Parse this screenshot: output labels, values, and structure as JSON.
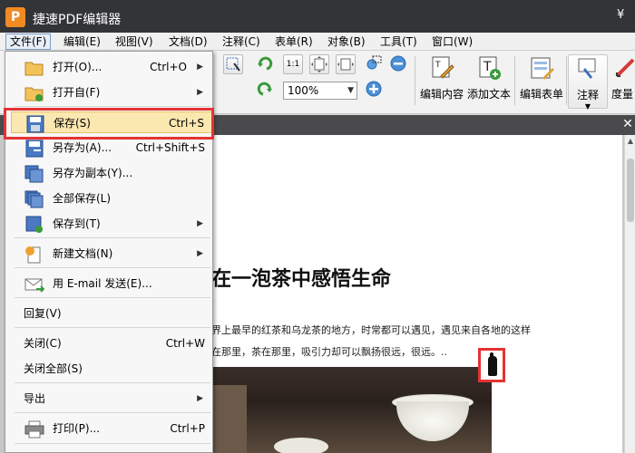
{
  "window": {
    "logo": "P",
    "title": "捷速PDF编辑器",
    "right_glyph": "¥"
  },
  "menubar": {
    "items": [
      "文件(F)",
      "编辑(E)",
      "视图(V)",
      "文档(D)",
      "注释(C)",
      "表单(R)",
      "对象(B)",
      "工具(T)",
      "窗口(W)"
    ],
    "active_index": 0
  },
  "toolbar": {
    "zoom_value": "100%",
    "rotate_label": "1:1",
    "tools": [
      {
        "label": "编辑内容",
        "icon": "edit-content-icon"
      },
      {
        "label": "添加文本",
        "icon": "add-text-icon"
      },
      {
        "label": "编辑表单",
        "icon": "edit-form-icon"
      },
      {
        "label": "注释",
        "icon": "annotation-icon"
      },
      {
        "label": "度量",
        "icon": "measure-icon"
      }
    ]
  },
  "file_menu": {
    "items": [
      {
        "label": "打开(O)...",
        "shortcut": "Ctrl+O",
        "submenu": true,
        "icon": "open-folder-icon"
      },
      {
        "label": "打开自(F)",
        "shortcut": "",
        "submenu": true,
        "icon": "open-from-icon"
      },
      {
        "label": "保存(S)",
        "shortcut": "Ctrl+S",
        "submenu": false,
        "icon": "save-icon",
        "highlighted": true
      },
      {
        "label": "另存为(A)...",
        "shortcut": "Ctrl+Shift+S",
        "submenu": false,
        "icon": "save-as-icon"
      },
      {
        "label": "另存为副本(Y)...",
        "shortcut": "",
        "submenu": false,
        "icon": "save-copy-icon"
      },
      {
        "label": "全部保存(L)",
        "shortcut": "",
        "submenu": false,
        "icon": "save-all-icon"
      },
      {
        "label": "保存到(T)",
        "shortcut": "",
        "submenu": true,
        "icon": "save-to-icon"
      },
      {
        "label": "新建文档(N)",
        "shortcut": "",
        "submenu": true,
        "icon": "new-document-icon"
      },
      {
        "label": "用 E-mail 发送(E)...",
        "shortcut": "",
        "submenu": false,
        "icon": "email-icon"
      },
      {
        "label": "回复(V)",
        "shortcut": "",
        "submenu": false
      },
      {
        "label": "关闭(C)",
        "shortcut": "Ctrl+W",
        "submenu": false
      },
      {
        "label": "关闭全部(S)",
        "shortcut": "",
        "submenu": false
      },
      {
        "label": "导出",
        "shortcut": "",
        "submenu": true
      },
      {
        "label": "打印(P)...",
        "shortcut": "Ctrl+P",
        "submenu": false,
        "icon": "print-icon"
      }
    ],
    "submenu_glyph": "▶"
  },
  "document": {
    "title": "在一泡茶中感悟生命",
    "lines": [
      "界上最早的红茶和乌龙茶的地方，时常都可以遇见，遇见来自各地的这样",
      "在那里，茶在那里，吸引力却可以飘扬很远，很远。.."
    ]
  },
  "colors": {
    "titlebar": "#333438",
    "highlight": "#fbe7b0",
    "callout": "#e53333"
  }
}
